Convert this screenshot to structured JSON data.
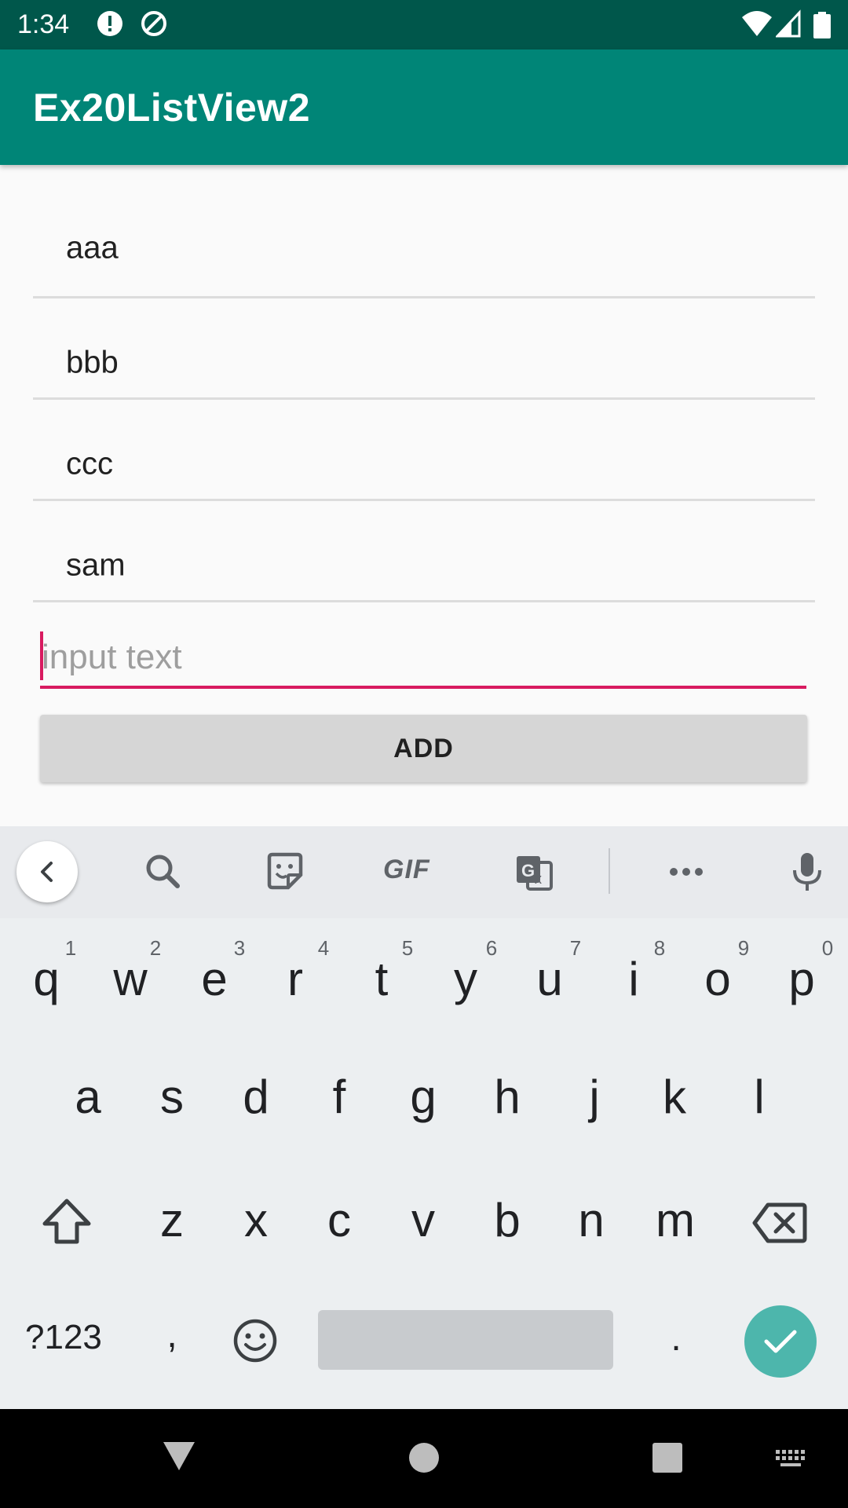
{
  "status_bar": {
    "time": "1:34",
    "icons": [
      "alert-icon",
      "data-saver-icon",
      "wifi-icon",
      "signal-icon",
      "battery-icon"
    ]
  },
  "app_bar": {
    "title": "Ex20ListView2"
  },
  "list": {
    "items": [
      "aaa",
      "bbb",
      "ccc",
      "sam"
    ]
  },
  "input": {
    "value": "",
    "placeholder": "input text"
  },
  "add_button": {
    "label": "ADD"
  },
  "keyboard": {
    "toolbar": {
      "gif_label": "GIF",
      "tools": [
        "back-icon",
        "search-icon",
        "sticker-icon",
        "gif-icon",
        "translate-icon",
        "more-icon",
        "mic-icon"
      ]
    },
    "row1": [
      {
        "key": "q",
        "num": "1"
      },
      {
        "key": "w",
        "num": "2"
      },
      {
        "key": "e",
        "num": "3"
      },
      {
        "key": "r",
        "num": "4"
      },
      {
        "key": "t",
        "num": "5"
      },
      {
        "key": "y",
        "num": "6"
      },
      {
        "key": "u",
        "num": "7"
      },
      {
        "key": "i",
        "num": "8"
      },
      {
        "key": "o",
        "num": "9"
      },
      {
        "key": "p",
        "num": "0"
      }
    ],
    "row2": [
      "a",
      "s",
      "d",
      "f",
      "g",
      "h",
      "j",
      "k",
      "l"
    ],
    "row3": [
      "z",
      "x",
      "c",
      "v",
      "b",
      "n",
      "m"
    ],
    "row4": {
      "symbols": "?123",
      "comma": ",",
      "period": "."
    }
  },
  "colors": {
    "status_bar": "#00574b",
    "app_bar": "#008577",
    "accent": "#d81b60",
    "enter_key": "#4db6ac"
  }
}
